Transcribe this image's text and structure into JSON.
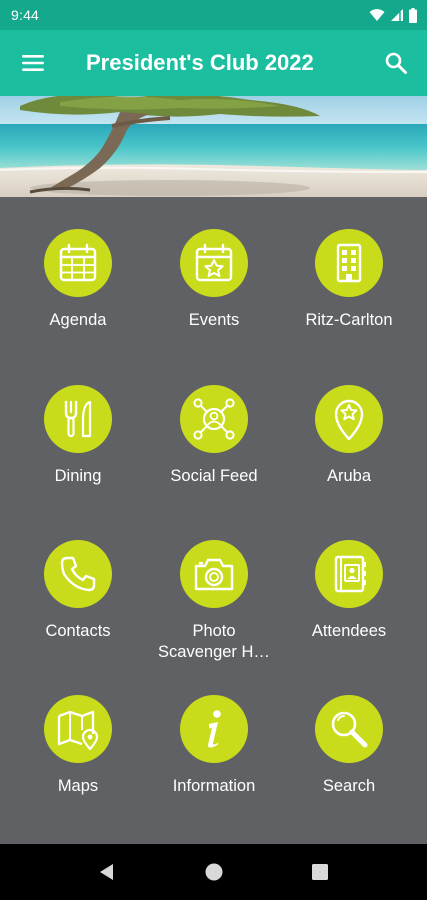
{
  "status_bar": {
    "time": "9:44",
    "icons": [
      "wifi-icon",
      "signal-icon",
      "battery-icon"
    ]
  },
  "app_bar": {
    "title": "President's Club 2022",
    "menu_icon": "hamburger-menu-icon",
    "search_icon": "search-icon",
    "color": "#1bbf9f"
  },
  "grid": {
    "accent": "#c9dc1c",
    "background": "#5f6164",
    "tiles": [
      {
        "label": "Agenda",
        "icon": "calendar-grid-icon"
      },
      {
        "label": "Events",
        "icon": "calendar-star-icon"
      },
      {
        "label": "Ritz-Carlton",
        "icon": "hotel-building-icon"
      },
      {
        "label": "Dining",
        "icon": "fork-knife-icon"
      },
      {
        "label": "Social Feed",
        "icon": "social-network-icon"
      },
      {
        "label": "Aruba",
        "icon": "map-pin-star-icon"
      },
      {
        "label": "Contacts",
        "icon": "phone-icon"
      },
      {
        "label": "Photo\nScavenger H…",
        "icon": "camera-icon"
      },
      {
        "label": "Attendees",
        "icon": "address-book-icon"
      },
      {
        "label": "Maps",
        "icon": "map-icon"
      },
      {
        "label": "Information",
        "icon": "info-icon"
      },
      {
        "label": "Search",
        "icon": "magnifier-icon"
      }
    ]
  },
  "nav_bar": {
    "buttons": [
      "back-icon",
      "home-icon",
      "recents-icon"
    ]
  }
}
